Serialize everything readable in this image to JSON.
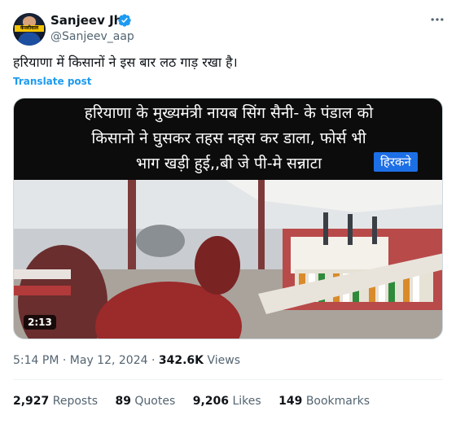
{
  "author": {
    "name": "Sanjeev Jha",
    "handle": "@Sanjeev_aap",
    "avatar_text": "केजरीवाल"
  },
  "tweet": {
    "text": "हरियाणा में किसानों ने इस बार लठ गाड़ रखा है।",
    "translate_label": "Translate post"
  },
  "media": {
    "caption_lines": [
      "हरियाणा के मुख्यमंत्री नायब सिंग सैनी- के पंडाल को",
      "किसानो ने घुसकर  तहस नहस कर डाला, फोर्स भी",
      "भाग खड़ी हुई,,बी जे पी-मे सन्नाटा"
    ],
    "badge": "हिरकने",
    "duration": "2:13"
  },
  "meta": {
    "time": "5:14 PM",
    "date": "May 12, 2024",
    "views_count": "342.6K",
    "views_label": "Views"
  },
  "stats": {
    "reposts_count": "2,927",
    "reposts_label": "Reposts",
    "quotes_count": "89",
    "quotes_label": "Quotes",
    "likes_count": "9,206",
    "likes_label": "Likes",
    "bookmarks_count": "149",
    "bookmarks_label": "Bookmarks"
  },
  "colors": {
    "accent": "#1d9bf0",
    "secondary_text": "#536471",
    "badge": "#1d6fe6"
  }
}
